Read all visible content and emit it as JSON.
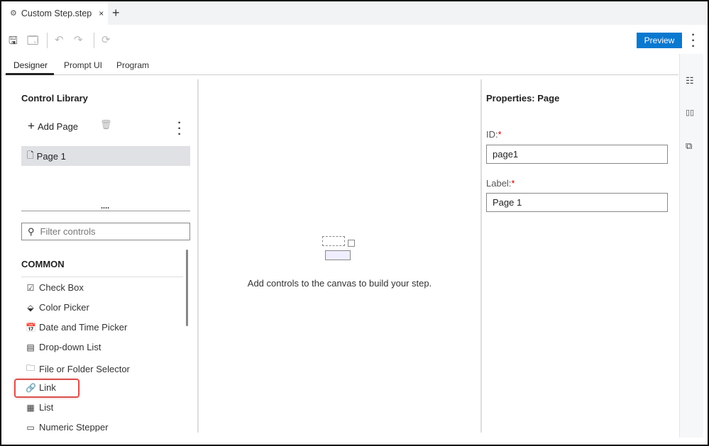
{
  "file_tab": {
    "title": "Custom Step.step",
    "close": "×",
    "add": "+"
  },
  "toolbar": {
    "preview_label": "Preview"
  },
  "tabs": [
    {
      "label": "Designer",
      "active": true
    },
    {
      "label": "Prompt UI"
    },
    {
      "label": "Program"
    }
  ],
  "left": {
    "title": "Control Library",
    "add_page": "Add Page",
    "pages": [
      "Page 1"
    ],
    "splitter": "....",
    "filter_placeholder": "Filter controls",
    "section": "COMMON",
    "controls": [
      {
        "label": "Check Box",
        "icon": "☑"
      },
      {
        "label": "Color Picker",
        "icon": "⬙"
      },
      {
        "label": "Date and Time Picker",
        "icon": "📅"
      },
      {
        "label": "Drop-down List",
        "icon": "▤"
      },
      {
        "label": "File or Folder Selector",
        "icon": "🗀"
      },
      {
        "label": "Link",
        "icon": "🔗"
      },
      {
        "label": "List",
        "icon": "▦"
      },
      {
        "label": "Numeric Stepper",
        "icon": "▭"
      }
    ]
  },
  "canvas": {
    "empty_message": "Add controls to the canvas to build your step."
  },
  "properties": {
    "title": "Properties: Page",
    "id_label": "ID:",
    "id_value": "page1",
    "label_label": "Label:",
    "label_value": "Page 1",
    "required_mark": "*"
  },
  "colors": {
    "accent": "#0b78d0",
    "highlight": "#d9534f"
  }
}
